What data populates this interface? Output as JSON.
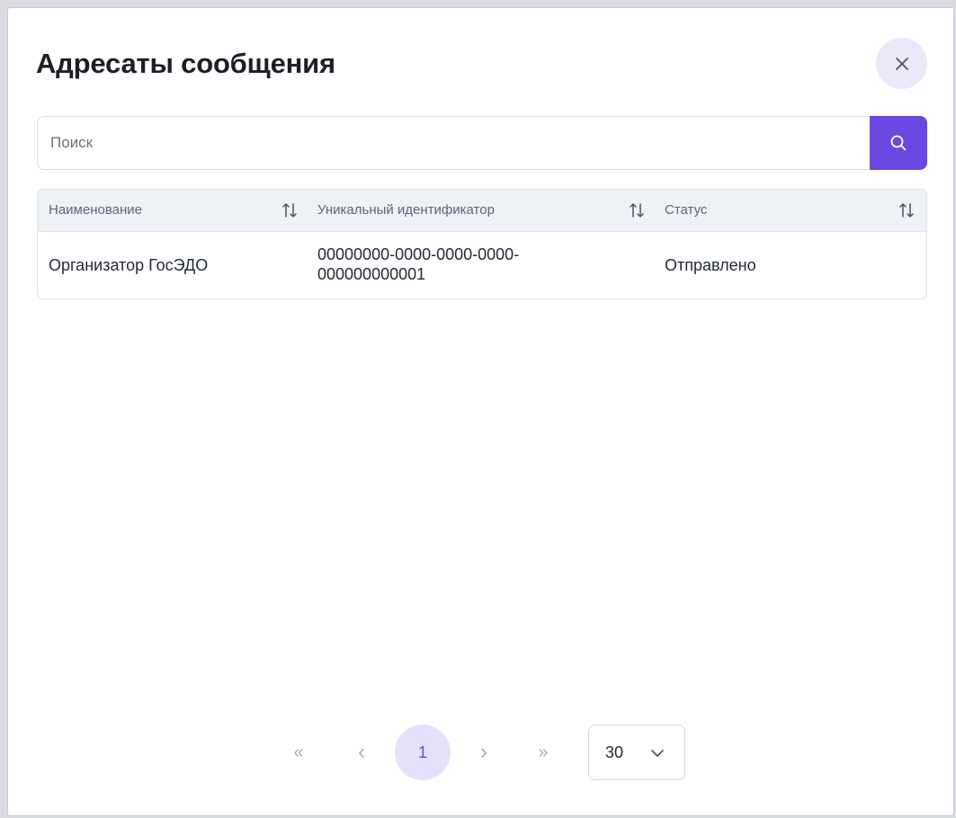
{
  "dialog": {
    "title": "Адресаты сообщения"
  },
  "search": {
    "placeholder": "Поиск",
    "value": ""
  },
  "table": {
    "columns": [
      {
        "label": "Наименование"
      },
      {
        "label": "Уникальный идентификатор"
      },
      {
        "label": "Статус"
      }
    ],
    "rows": [
      {
        "name": "Организатор ГосЭДО",
        "id_line1": "00000000-0000-0000-0000-",
        "id_line2": "000000000001",
        "status": "Отправлено"
      }
    ]
  },
  "pagination": {
    "first": "«",
    "prev": "‹",
    "current_page": "1",
    "next": "›",
    "last": "»",
    "page_size": "30"
  },
  "icons": {
    "close": "close-icon",
    "search": "search-icon",
    "sort": "sort-icon",
    "dropdown": "chevron-down-icon"
  },
  "colors": {
    "accent": "#6a47e0",
    "accent_light": "#e6e1fb",
    "header_bg": "#eef1f6",
    "text_dark": "#1c1f27",
    "text_muted": "#5d6577"
  }
}
